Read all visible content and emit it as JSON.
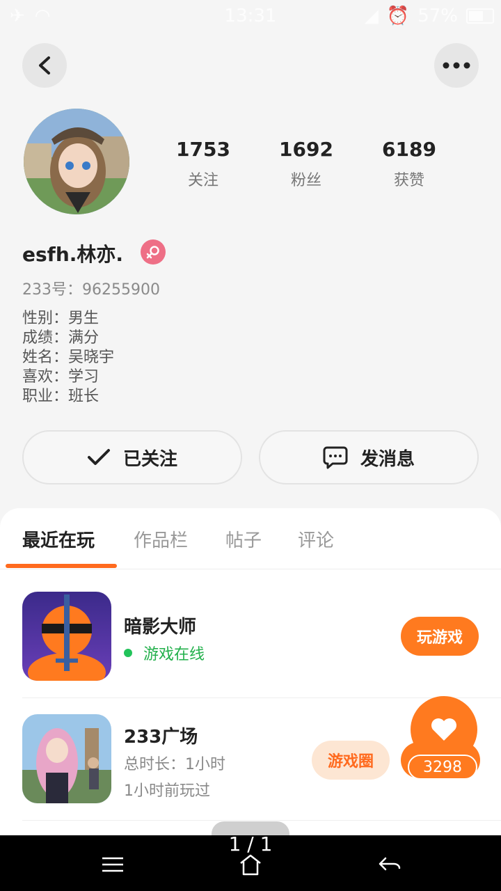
{
  "status_bar": {
    "time": "13:31",
    "battery": "57%"
  },
  "profile": {
    "username": "esfh.林亦.",
    "uid_label": "233号：96255900",
    "bio": [
      "性别：男生",
      "成绩：满分",
      "姓名：吴晓宇",
      "喜欢：学习",
      "职业：班长"
    ],
    "stats": [
      {
        "value": "1753",
        "label": "关注"
      },
      {
        "value": "1692",
        "label": "粉丝"
      },
      {
        "value": "6189",
        "label": "获赞"
      }
    ]
  },
  "actions": {
    "follow_label": "已关注",
    "message_label": "发消息"
  },
  "tabs": [
    "最近在玩",
    "作品栏",
    "帖子",
    "评论"
  ],
  "games": [
    {
      "name": "暗影大师",
      "status": "游戏在线",
      "button": "玩游戏"
    },
    {
      "name": "233广场",
      "duration": "总时长：1小时",
      "last_played": "1小时前玩过",
      "button": "游戏圈"
    }
  ],
  "like_count": "3298",
  "page_indicator": "1 / 1",
  "colors": {
    "accent": "#ff7a1f",
    "online": "#22b04b",
    "gender_badge": "#ee6f86"
  }
}
